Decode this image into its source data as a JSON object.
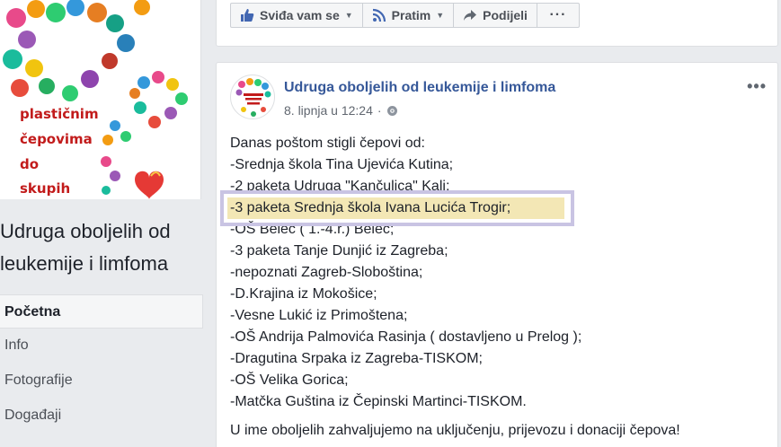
{
  "cover": {
    "lines": [
      "plastičnim",
      "čepovima",
      "do",
      "skupih"
    ]
  },
  "sidebar": {
    "page_name": "Udruga oboljelih od leukemije i limfoma",
    "items": [
      {
        "label": "Početna"
      },
      {
        "label": "Info"
      },
      {
        "label": "Fotografije"
      },
      {
        "label": "Događaji"
      }
    ]
  },
  "actions": {
    "like_label": "Sviđa vam se",
    "follow_label": "Pratim",
    "share_label": "Podijeli",
    "more_label": "···"
  },
  "post": {
    "author": "Udruga oboljelih od leukemije i limfoma",
    "date": "8. lipnja u 12:24",
    "separator": "·",
    "options_label": "•••",
    "lines": [
      "Danas poštom stigli čepovi od:",
      "-Srednja škola Tina Ujevića Kutina;",
      "-2 paketa Udruga \"Kančulica\" Kali;",
      "-3 paketa Srednja škola Ivana Lucića Trogir;",
      "-OŠ Belec ( 1.-4.r.) Belec;",
      "-3 paketa Tanje Dunjić iz Zagreba;",
      "-nepoznati Zagreb-Sloboština;",
      "-D.Krajina iz Mokošice;",
      "-Vesne Lukić iz Primoštena;",
      "-OŠ Andrija Palmovića Rasinja ( dostavljeno u Prelog );",
      "-Dragutina Srpaka iz Zagreba-TISKOM;",
      "-OŠ Velika Gorica;",
      "-Matčka Guština iz Čepinski Martinci-TISKOM."
    ],
    "closing": "U ime oboljelih zahvaljujemo na uključenju, prijevozu i donaciji čepova!"
  },
  "colors": {
    "link": "#365899",
    "highlight_fill": "#f3e7b5",
    "highlight_border": "#c9c4e3",
    "page_bg": "#e9ebee"
  }
}
